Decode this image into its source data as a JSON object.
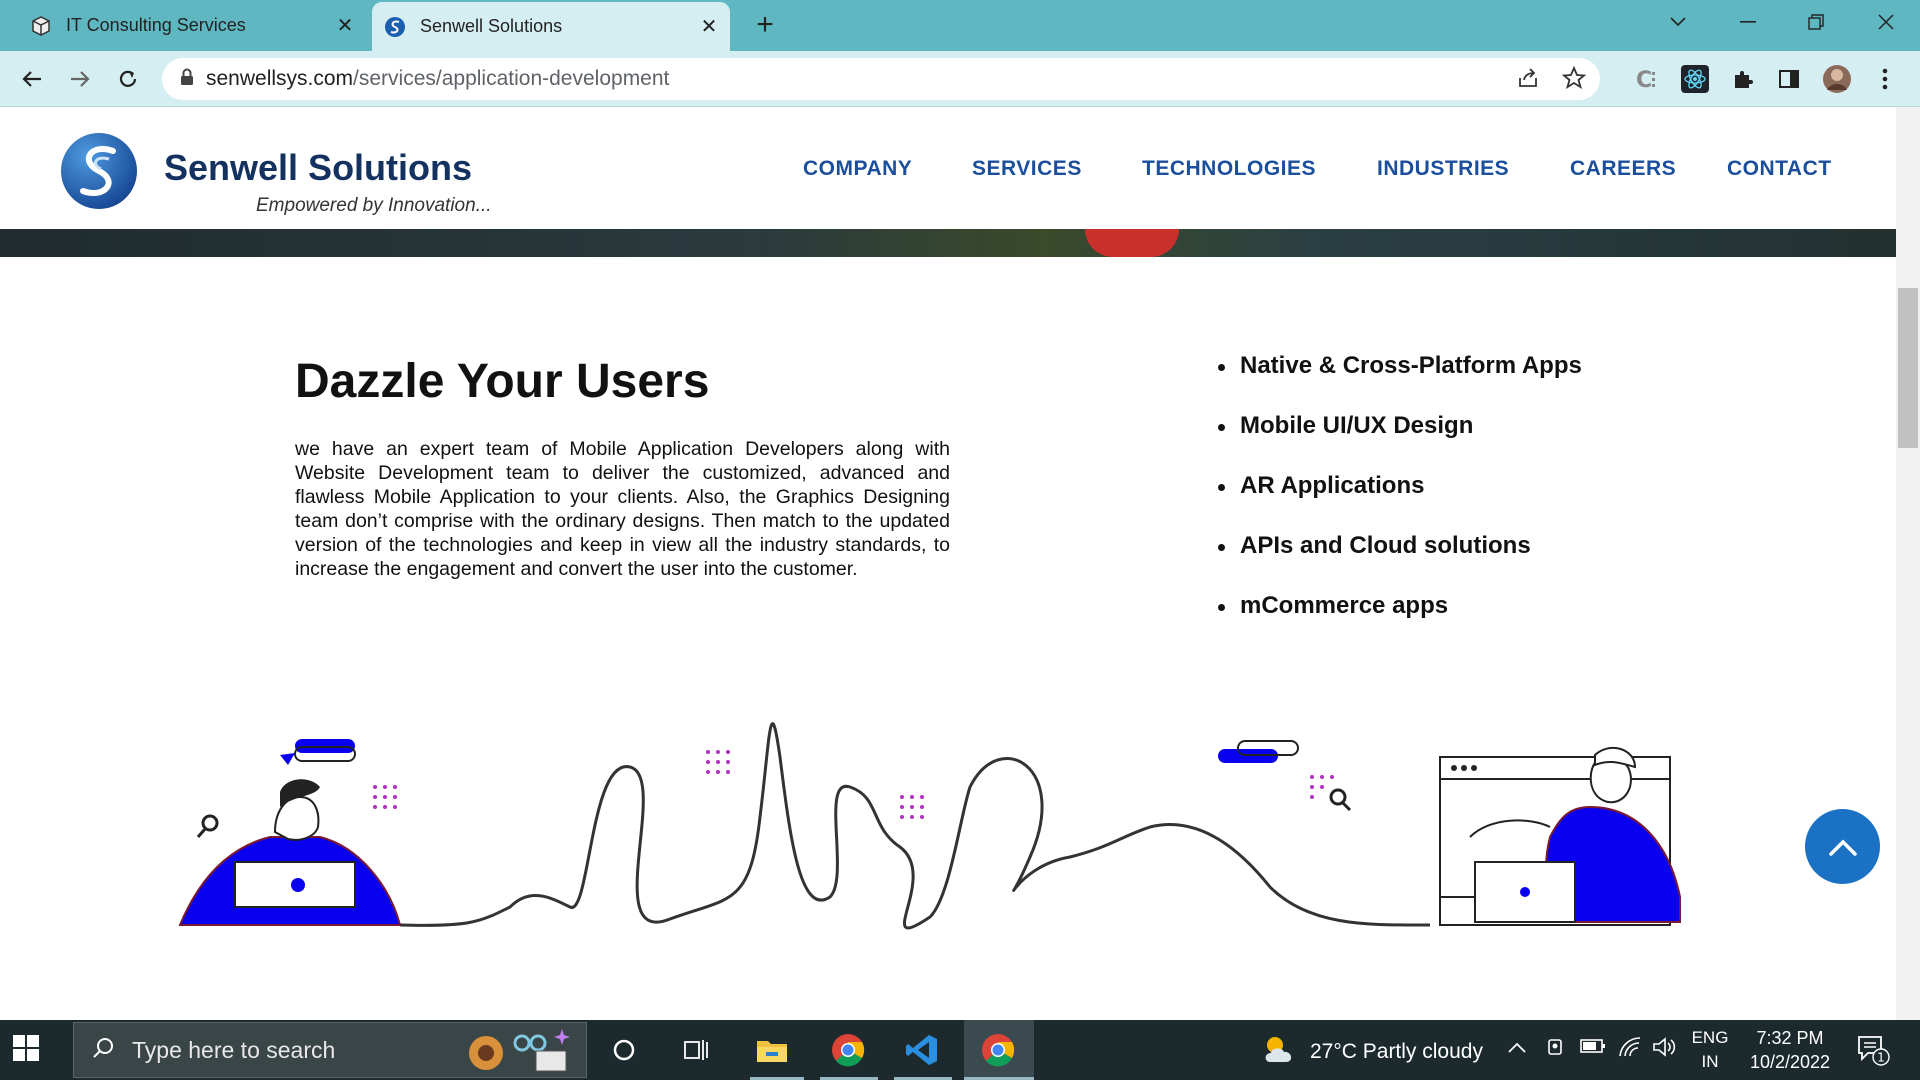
{
  "browser": {
    "tabs": [
      {
        "title": "IT Consulting Services",
        "active": false
      },
      {
        "title": "Senwell Solutions",
        "active": true
      }
    ],
    "url_domain": "senwellsys.com",
    "url_path": "/services/application-development"
  },
  "site": {
    "brand": "Senwell Solutions",
    "tagline": "Empowered by Innovation...",
    "nav": [
      "COMPANY",
      "SERVICES",
      "TECHNOLOGIES",
      "INDUSTRIES",
      "CAREERS",
      "CONTACT"
    ]
  },
  "content": {
    "heading": "Dazzle Your Users",
    "paragraph": "we have an expert team of Mobile Application Developers along with Website Development team to deliver the customized, advanced and flawless Mobile Application to your clients. Also, the Graphics Designing team don’t comprise with the ordinary designs. Then match to the updated version of the technologies and keep in view all the industry standards, to increase the engagement and convert the user into the customer.",
    "features": [
      "Native & Cross-Platform Apps",
      "Mobile UI/UX Design",
      "AR Applications",
      "APIs and Cloud solutions",
      "mCommerce apps"
    ]
  },
  "taskbar": {
    "search_placeholder": "Type here to search",
    "weather": "27°C  Partly cloudy",
    "lang_1": "ENG",
    "lang_2": "IN",
    "time": "7:32 PM",
    "date": "10/2/2022",
    "notifications": "1"
  },
  "colors": {
    "tabbar": "#5fb8c1",
    "toolbar": "#d5eef1",
    "nav_blue": "#1b4f9c",
    "illustration_blue": "#0a00f0",
    "taskbar": "#1c2a2e"
  }
}
